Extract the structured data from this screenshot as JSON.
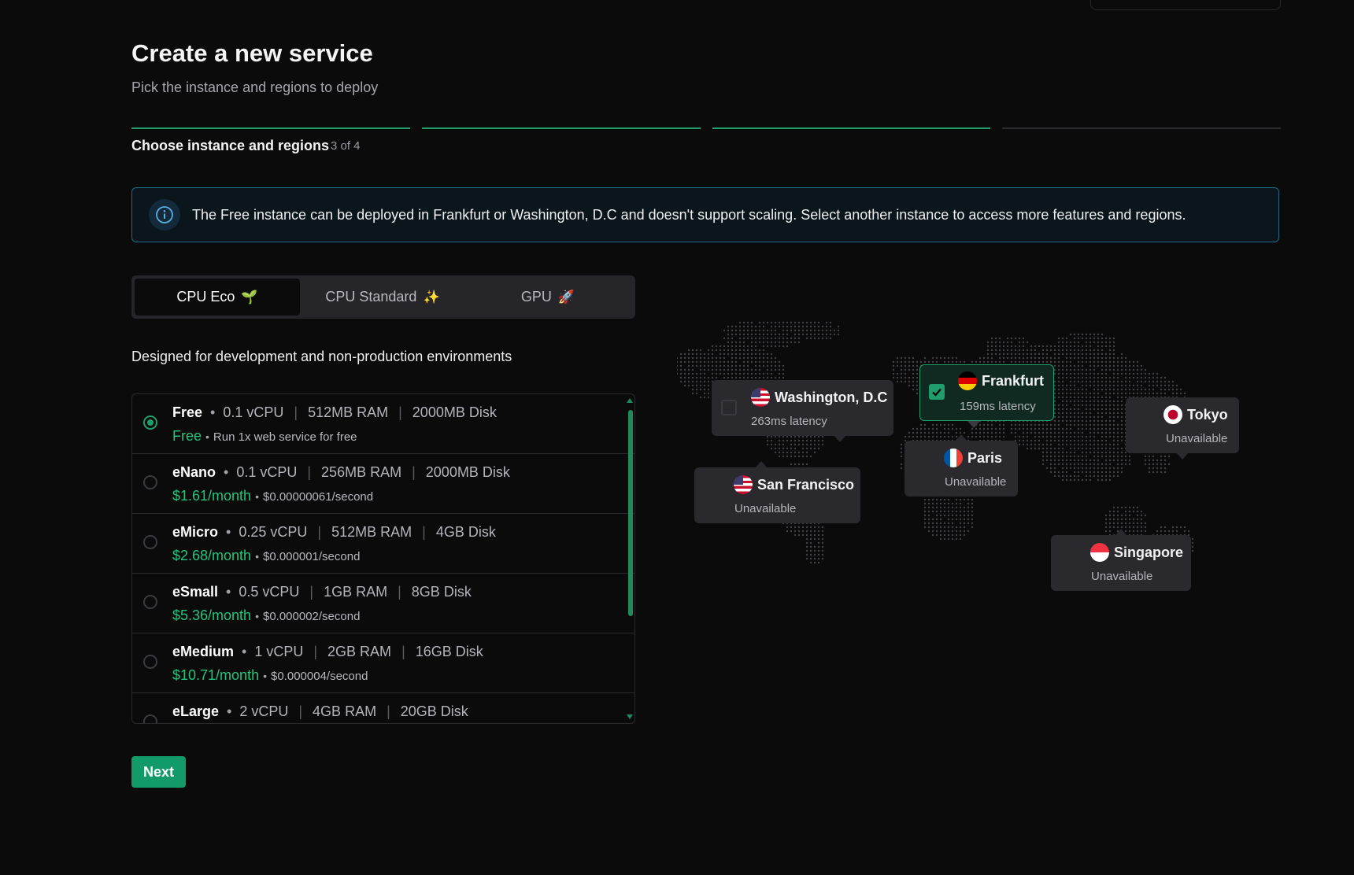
{
  "page": {
    "title": "Create a new service",
    "subtitle": "Pick the instance and regions to deploy"
  },
  "stepper": {
    "label": "Choose instance and regions",
    "count": "3 of 4",
    "steps_total": 4,
    "steps_completed": 3
  },
  "banner": {
    "icon": "info-icon",
    "text": "The Free instance can be deployed in Frankfurt or Washington, D.C and doesn't support scaling. Select another instance to access more features and regions."
  },
  "tabs": [
    {
      "label": "CPU Eco",
      "emoji": "🌱",
      "active": true
    },
    {
      "label": "CPU Standard",
      "emoji": "✨",
      "active": false
    },
    {
      "label": "GPU",
      "emoji": "🚀",
      "active": false
    }
  ],
  "tab_description": "Designed for development and non-production environments",
  "instances": [
    {
      "name": "Free",
      "cpu": "0.1 vCPU",
      "ram": "512MB RAM",
      "disk": "2000MB Disk",
      "price": "Free",
      "per_second": "Run 1x web service for free",
      "selected": true
    },
    {
      "name": "eNano",
      "cpu": "0.1 vCPU",
      "ram": "256MB RAM",
      "disk": "2000MB Disk",
      "price": "$1.61/month",
      "per_second": "$0.00000061/second",
      "selected": false
    },
    {
      "name": "eMicro",
      "cpu": "0.25 vCPU",
      "ram": "512MB RAM",
      "disk": "4GB Disk",
      "price": "$2.68/month",
      "per_second": "$0.000001/second",
      "selected": false
    },
    {
      "name": "eSmall",
      "cpu": "0.5 vCPU",
      "ram": "1GB RAM",
      "disk": "8GB Disk",
      "price": "$5.36/month",
      "per_second": "$0.000002/second",
      "selected": false
    },
    {
      "name": "eMedium",
      "cpu": "1 vCPU",
      "ram": "2GB RAM",
      "disk": "16GB Disk",
      "price": "$10.71/month",
      "per_second": "$0.000004/second",
      "selected": false
    },
    {
      "name": "eLarge",
      "cpu": "2 vCPU",
      "ram": "4GB RAM",
      "disk": "20GB Disk",
      "price": "",
      "per_second": "",
      "selected": false
    }
  ],
  "regions": {
    "washington": {
      "name": "Washington, D.C",
      "status": "263ms latency",
      "flag": "us-flag",
      "checked": false
    },
    "frankfurt": {
      "name": "Frankfurt",
      "status": "159ms latency",
      "flag": "de-flag",
      "checked": true
    },
    "tokyo": {
      "name": "Tokyo",
      "status": "Unavailable",
      "flag": "jp-flag",
      "checked": false
    },
    "paris": {
      "name": "Paris",
      "status": "Unavailable",
      "flag": "fr-flag",
      "checked": false
    },
    "sanfrancisco": {
      "name": "San Francisco",
      "status": "Unavailable",
      "flag": "us-flag",
      "checked": false
    },
    "singapore": {
      "name": "Singapore",
      "status": "Unavailable",
      "flag": "sg-flag",
      "checked": false
    }
  },
  "actions": {
    "next_label": "Next"
  },
  "colors": {
    "accent": "#1f9d6b",
    "price_green": "#22c47f",
    "banner_border": "#1d6b83",
    "background": "#0b0b0c"
  }
}
